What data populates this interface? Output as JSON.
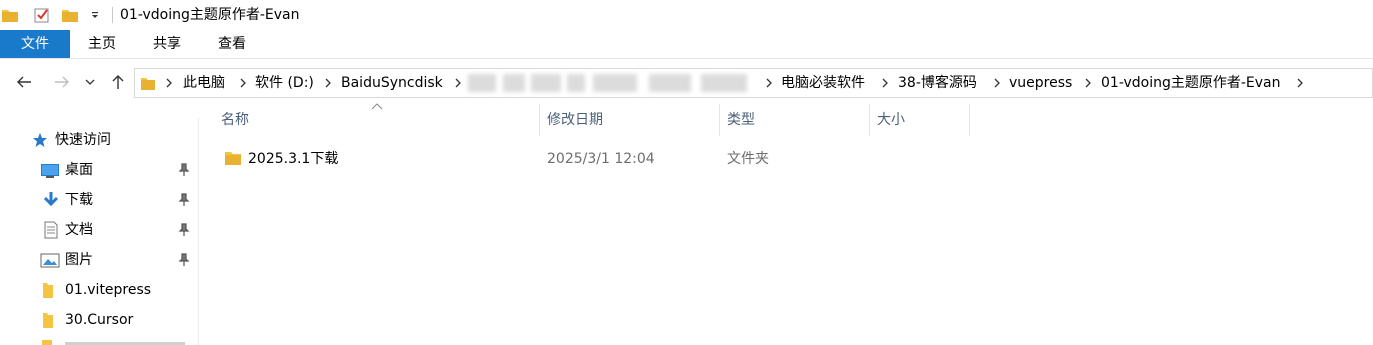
{
  "window": {
    "title": "01-vdoing主题原作者-Evan"
  },
  "ribbon": {
    "tabs": [
      "文件",
      "主页",
      "共享",
      "查看"
    ]
  },
  "address": {
    "crumbs_before": [
      "此电脑",
      "软件 (D:)",
      "BaiduSyncdisk"
    ],
    "crumbs_after": [
      "电脑必装软件",
      "38-博客源码",
      "vuepress",
      "01-vdoing主题原作者-Evan"
    ]
  },
  "nav": {
    "quick_access": "快速访问",
    "items": [
      {
        "label": "桌面",
        "icon": "desktop-icon",
        "pinned": true
      },
      {
        "label": "下载",
        "icon": "download-icon",
        "pinned": true
      },
      {
        "label": "文档",
        "icon": "document-icon",
        "pinned": true
      },
      {
        "label": "图片",
        "icon": "pictures-icon",
        "pinned": true
      },
      {
        "label": "01.vitepress",
        "icon": "folder-icon",
        "pinned": false
      },
      {
        "label": "30.Cursor",
        "icon": "folder-icon",
        "pinned": false
      }
    ]
  },
  "columns": {
    "name": "名称",
    "date": "修改日期",
    "type": "类型",
    "size": "大小"
  },
  "files": [
    {
      "name": "2025.3.1下载",
      "date": "2025/3/1 12:04",
      "type": "文件夹",
      "size": ""
    }
  ],
  "colors": {
    "accent": "#1979ca",
    "folder": "#f5c542",
    "header_text": "#4c607a"
  }
}
